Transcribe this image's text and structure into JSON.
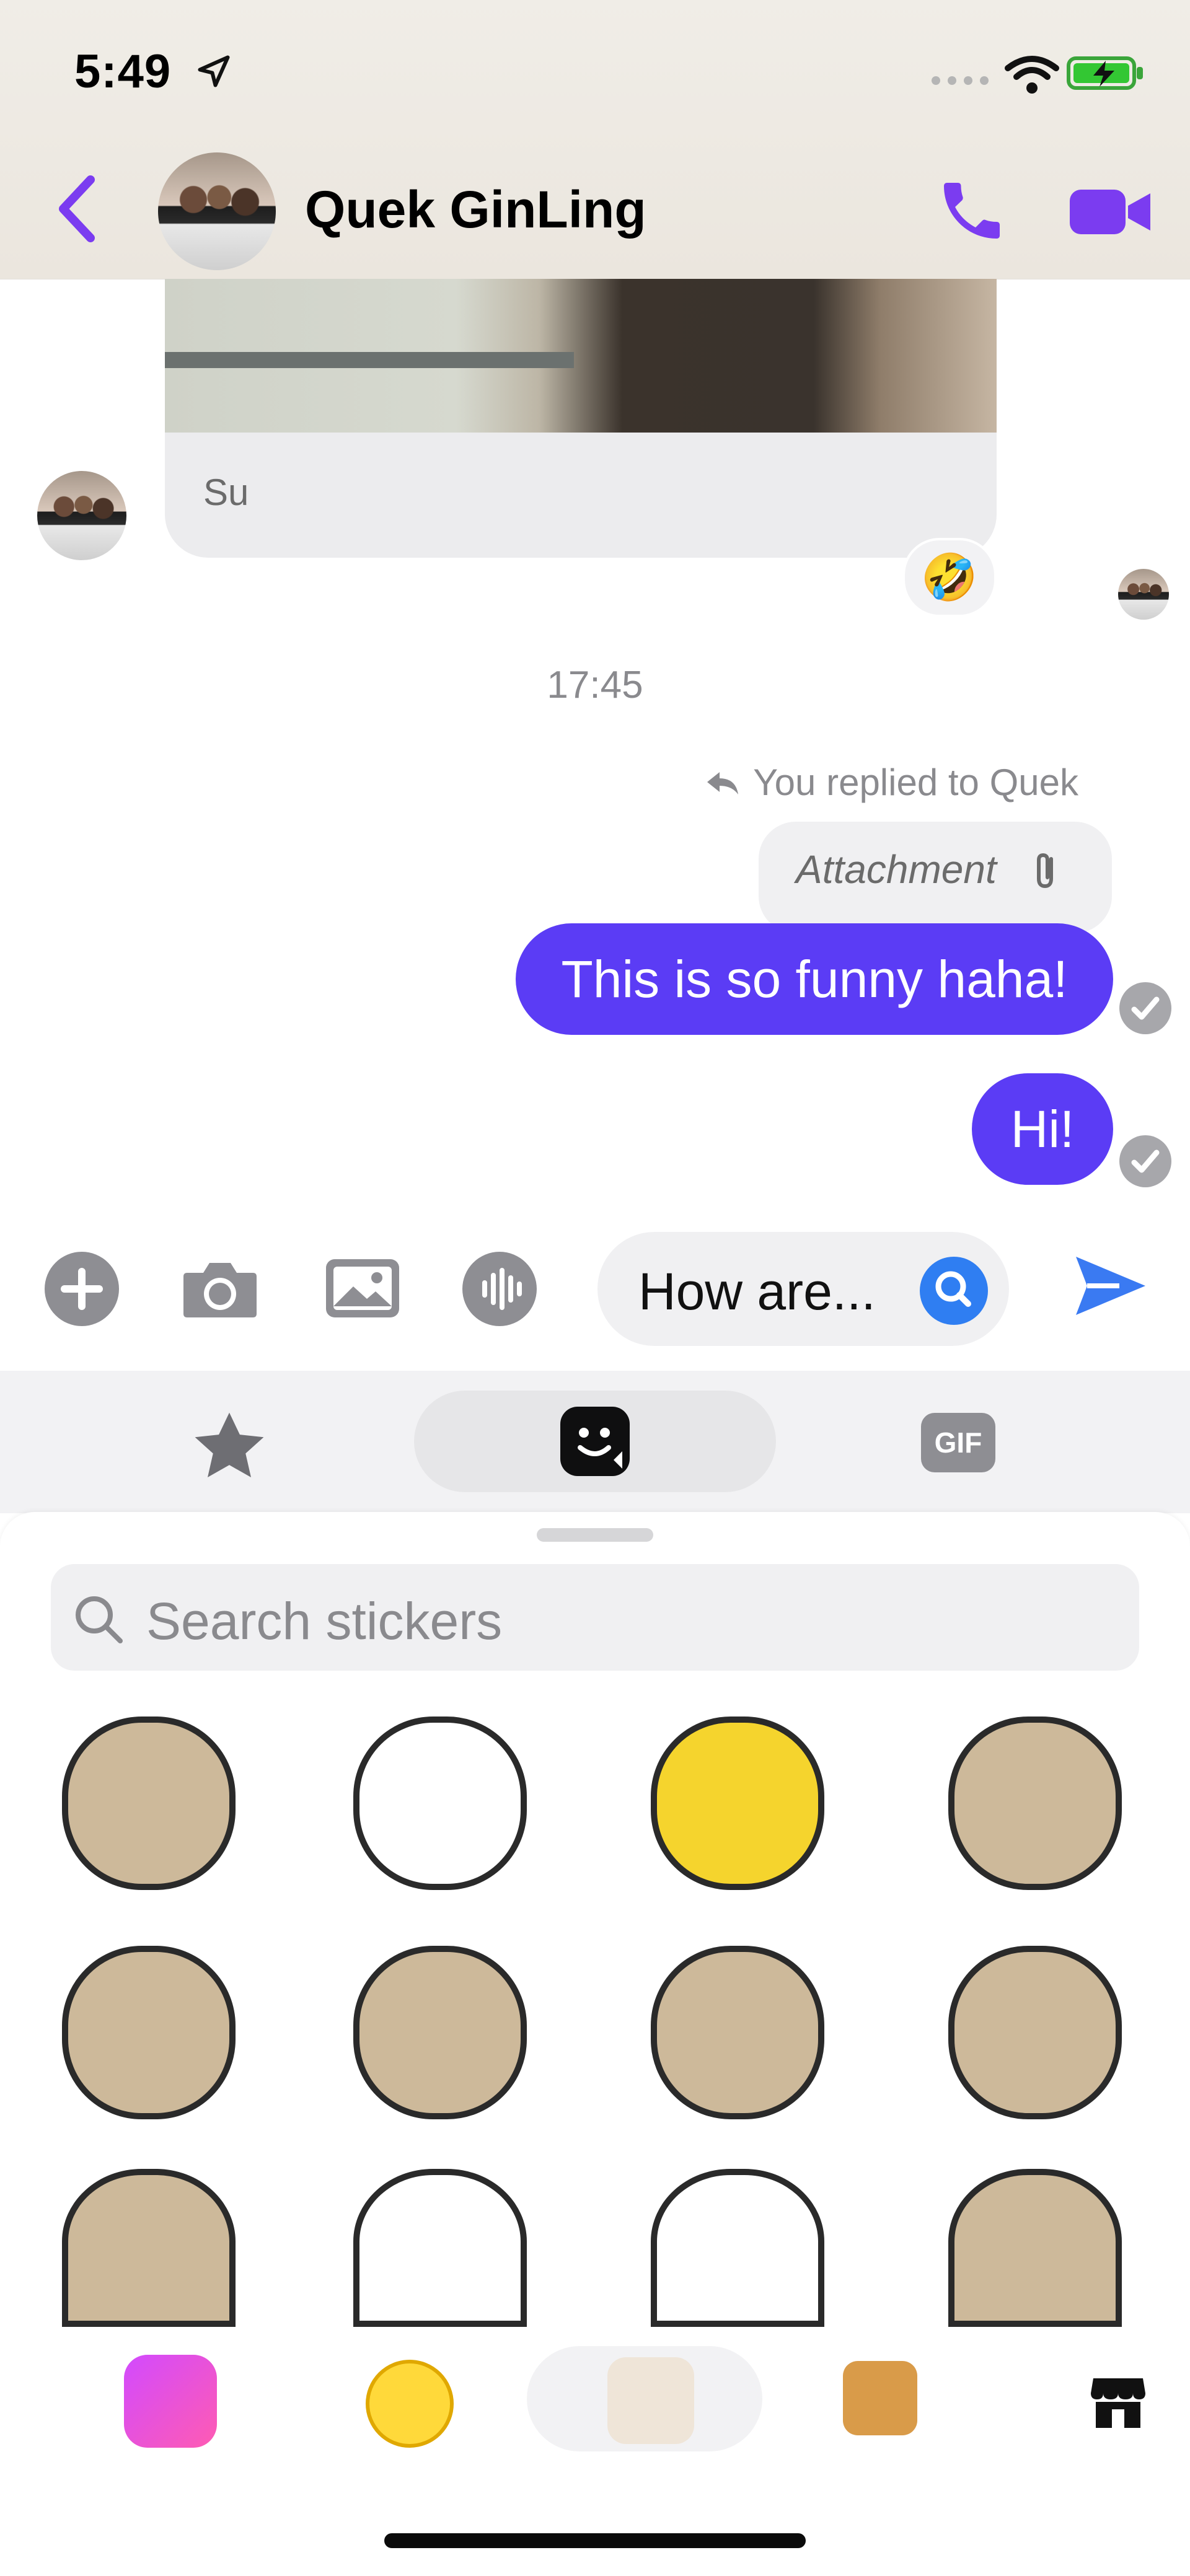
{
  "status_bar": {
    "time": "5:49"
  },
  "header": {
    "contact_name": "Quek GinLing"
  },
  "messages": {
    "photo_label": "Su",
    "reaction_emoji": "🤣",
    "timestamp": "17:45",
    "replied_to": "You replied to Quek",
    "attachment_label": "Attachment",
    "bubbles": [
      "This is so funny haha!",
      "Hi!"
    ]
  },
  "composer": {
    "input_value": "How are..."
  },
  "sticker_tabs": {
    "gif_label": "GIF"
  },
  "sticker_search": {
    "placeholder": "Search stickers"
  },
  "colors": {
    "accent_purple": "#5b3cf5",
    "header_icon_purple": "#7b3cf0",
    "search_blue": "#2f7ef2",
    "send_blue": "#3a7af2"
  },
  "icons": [
    "location-arrow-icon",
    "signal-icon",
    "wifi-icon",
    "battery-icon",
    "back-chevron-icon",
    "phone-icon",
    "video-camera-icon",
    "reply-arrow-icon",
    "paperclip-icon",
    "checkmark-icon",
    "plus-icon",
    "camera-icon",
    "image-icon",
    "audio-icon",
    "search-icon",
    "send-icon",
    "star-icon",
    "sticker-icon",
    "gif-icon",
    "store-icon"
  ]
}
